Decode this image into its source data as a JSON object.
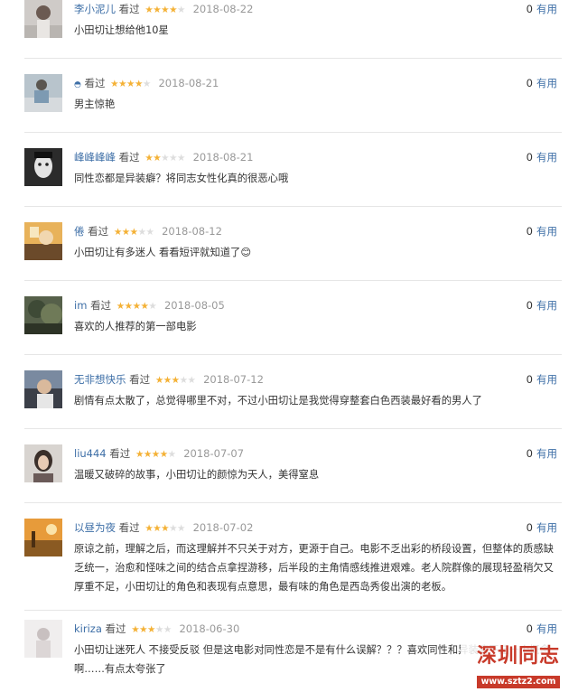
{
  "colors": {
    "star_on": "#f4b135",
    "star_off": "#dddddd",
    "username": "#3e6fa7"
  },
  "reviews": [
    {
      "user": "李小泥儿",
      "status": "看过",
      "stars_filled": 4,
      "date": "2018-08-22",
      "useful_count": "0",
      "useful_label": "有用",
      "comment": "小田切让想给他10星"
    },
    {
      "user": "",
      "user_icon": "avatar-glyph-icon",
      "status": "看过",
      "stars_filled": 4,
      "date": "2018-08-21",
      "useful_count": "0",
      "useful_label": "有用",
      "comment": "男主惊艳"
    },
    {
      "user": "峰峰峰峰",
      "status": "看过",
      "stars_filled": 2,
      "date": "2018-08-21",
      "useful_count": "0",
      "useful_label": "有用",
      "comment": "同性恋都是异装癖？将同志女性化真的很恶心哦"
    },
    {
      "user": "倦",
      "status": "看过",
      "stars_filled": 3,
      "date": "2018-08-12",
      "useful_count": "0",
      "useful_label": "有用",
      "comment": "小田切让有多迷人 看看短评就知道了😊"
    },
    {
      "user": "im",
      "status": "看过",
      "stars_filled": 4,
      "date": "2018-08-05",
      "useful_count": "0",
      "useful_label": "有用",
      "comment": "喜欢的人推荐的第一部电影"
    },
    {
      "user": "无非想快乐",
      "status": "看过",
      "stars_filled": 3,
      "date": "2018-07-12",
      "useful_count": "0",
      "useful_label": "有用",
      "comment": "剧情有点太散了，总觉得哪里不对，不过小田切让是我觉得穿整套白色西装最好看的男人了"
    },
    {
      "user": "liu444",
      "status": "看过",
      "stars_filled": 4,
      "date": "2018-07-07",
      "useful_count": "0",
      "useful_label": "有用",
      "comment": "温暖又破碎的故事，小田切让的颜惊为天人，美得窒息"
    },
    {
      "user": "以昼为夜",
      "status": "看过",
      "stars_filled": 3,
      "date": "2018-07-02",
      "useful_count": "0",
      "useful_label": "有用",
      "comment": "原谅之前，理解之后，而这理解并不只关于对方，更源于自己。电影不乏出彩的桥段设置，但整体的质感缺乏统一，治愈和怪味之间的结合点拿捏游移，后半段的主角情感线推进艰难。老人院群像的展现轻盈稍欠又厚重不足，小田切让的角色和表现有点意思，最有味的角色是西岛秀俊出演的老板。"
    },
    {
      "user": "kiriza",
      "status": "看过",
      "stars_filled": 3,
      "date": "2018-06-30",
      "useful_count": "0",
      "useful_label": "有用",
      "comment": "小田切让迷死人 不接受反驳 但是这电影对同性恋是不是有什么误解？？？喜欢同性和异装癖不是一个概念啊……有点太夸张了"
    }
  ],
  "watermark": {
    "title": "深圳同志",
    "url": "www.sztz2.com"
  }
}
